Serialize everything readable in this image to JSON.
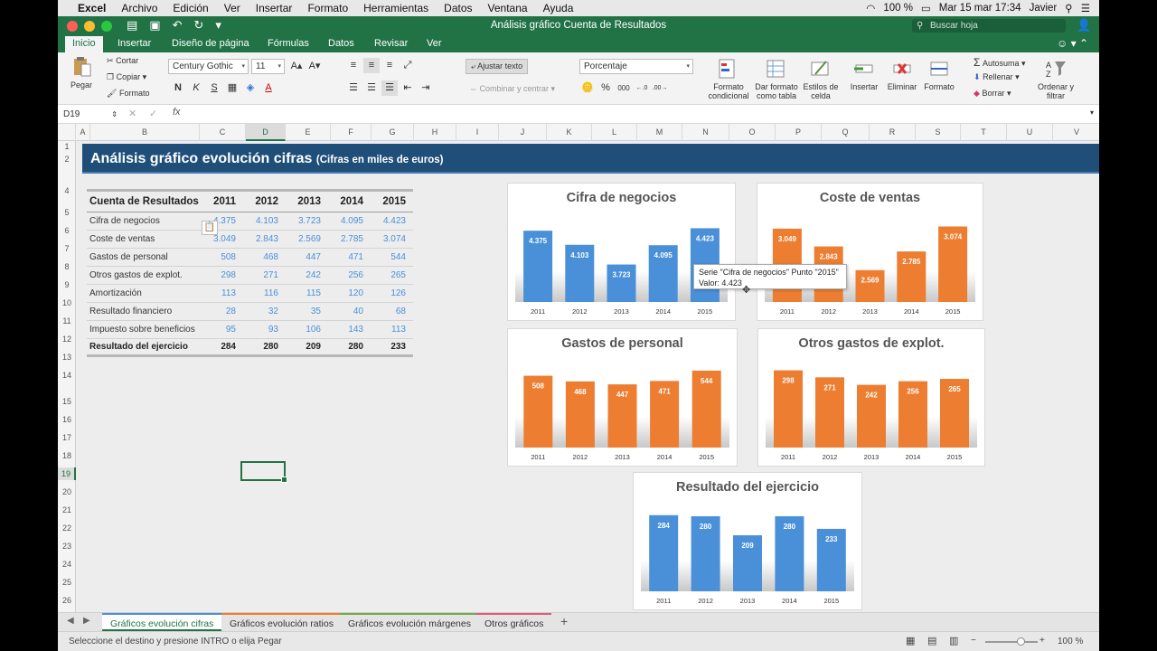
{
  "menubar": {
    "app": "Excel",
    "items": [
      "Archivo",
      "Edición",
      "Ver",
      "Insertar",
      "Formato",
      "Herramientas",
      "Datos",
      "Ventana",
      "Ayuda"
    ],
    "battery": "100 %",
    "datetime": "Mar 15 mar 17:34",
    "user": "Javier"
  },
  "window": {
    "title": "Análisis gráfico Cuenta de Resultados",
    "search_placeholder": "Buscar hoja"
  },
  "ribbon_tabs": [
    "Inicio",
    "Insertar",
    "Diseño de página",
    "Fórmulas",
    "Datos",
    "Revisar",
    "Ver"
  ],
  "ribbon": {
    "paste": "Pegar",
    "cut": "Cortar",
    "copy": "Copiar",
    "format_painter": "Formato",
    "font_name": "Century Gothic",
    "font_size": "11",
    "bold": "N",
    "italic": "K",
    "underline": "S",
    "wrap_text": "Ajustar texto",
    "merge": "Combinar y centrar",
    "number_format": "Porcentaje",
    "percent": "%",
    "thousands": "000",
    "cond_format": "Formato condicional",
    "table_format": "Dar formato como tabla",
    "cell_styles": "Estilos de celda",
    "insert": "Insertar",
    "delete": "Eliminar",
    "format": "Formato",
    "autosum": "Autosuma",
    "fill": "Rellenar",
    "clear": "Borrar",
    "sort_filter": "Ordenar y filtrar"
  },
  "formula_bar": {
    "name_box": "D19",
    "fx": "fx",
    "value": ""
  },
  "columns": [
    "A",
    "B",
    "C",
    "D",
    "E",
    "F",
    "G",
    "H",
    "I",
    "J",
    "K",
    "L",
    "M",
    "N",
    "O",
    "P",
    "Q",
    "R",
    "S",
    "T",
    "U",
    "V"
  ],
  "selected_column": "D",
  "rows": [
    "1",
    "2",
    "4",
    "5",
    "6",
    "7",
    "8",
    "9",
    "10",
    "11",
    "12",
    "13",
    "14",
    "15",
    "16",
    "17",
    "18",
    "19",
    "20",
    "21",
    "22",
    "23",
    "24",
    "25",
    "26"
  ],
  "selected_row": "19",
  "banner": {
    "title": "Análisis gráfico evolución cifras",
    "subtitle": "(Cifras en miles de euros)"
  },
  "table": {
    "header": [
      "Cuenta de Resultados",
      "2011",
      "2012",
      "2013",
      "2014",
      "2015"
    ],
    "rows": [
      [
        "Cifra de negocios",
        "4.375",
        "4.103",
        "3.723",
        "4.095",
        "4.423"
      ],
      [
        "Coste de ventas",
        "3.049",
        "2.843",
        "2.569",
        "2.785",
        "3.074"
      ],
      [
        "Gastos de personal",
        "508",
        "468",
        "447",
        "471",
        "544"
      ],
      [
        "Otros gastos de explot.",
        "298",
        "271",
        "242",
        "256",
        "265"
      ],
      [
        "Amortización",
        "113",
        "116",
        "115",
        "120",
        "126"
      ],
      [
        "Resultado financiero",
        "28",
        "32",
        "35",
        "40",
        "68"
      ],
      [
        "Impuesto sobre beneficios",
        "95",
        "93",
        "106",
        "143",
        "113"
      ]
    ],
    "total": [
      "Resultado del ejercicio",
      "284",
      "280",
      "209",
      "280",
      "233"
    ]
  },
  "chart_data": [
    {
      "type": "bar",
      "title": "Cifra de negocios",
      "categories": [
        "2011",
        "2012",
        "2013",
        "2014",
        "2015"
      ],
      "values": [
        4375,
        4103,
        3723,
        4095,
        4423
      ],
      "labels": [
        "4.375",
        "4.103",
        "3.723",
        "4.095",
        "4.423"
      ],
      "ylim": [
        3000,
        4500
      ],
      "color": "#4a90d9"
    },
    {
      "type": "bar",
      "title": "Coste de ventas",
      "categories": [
        "2011",
        "2012",
        "2013",
        "2014",
        "2015"
      ],
      "values": [
        3049,
        2843,
        2569,
        2785,
        3074
      ],
      "labels": [
        "3.049",
        "2.843",
        "2.569",
        "2.785",
        "3.074"
      ],
      "ylim": [
        2200,
        3100
      ],
      "color": "#ed7d31"
    },
    {
      "type": "bar",
      "title": "Gastos de personal",
      "categories": [
        "2011",
        "2012",
        "2013",
        "2014",
        "2015"
      ],
      "values": [
        508,
        468,
        447,
        471,
        544
      ],
      "labels": [
        "508",
        "468",
        "447",
        "471",
        "544"
      ],
      "ylim": [
        0,
        550
      ],
      "color": "#ed7d31"
    },
    {
      "type": "bar",
      "title": "Otros gastos de explot.",
      "categories": [
        "2011",
        "2012",
        "2013",
        "2014",
        "2015"
      ],
      "values": [
        298,
        271,
        242,
        256,
        265
      ],
      "labels": [
        "298",
        "271",
        "242",
        "256",
        "265"
      ],
      "ylim": [
        0,
        300
      ],
      "color": "#ed7d31"
    },
    {
      "type": "bar",
      "title": "Resultado del ejercicio",
      "categories": [
        "2011",
        "2012",
        "2013",
        "2014",
        "2015"
      ],
      "values": [
        284,
        280,
        209,
        280,
        233
      ],
      "labels": [
        "284",
        "280",
        "209",
        "280",
        "233"
      ],
      "ylim": [
        0,
        290
      ],
      "color": "#4a90d9"
    }
  ],
  "tooltip": {
    "line1": "Serie \"Cifra de negocios\" Punto \"2015\"",
    "line2": "Valor: 4.423"
  },
  "sheet_tabs": [
    "Gráficos evolución cifras",
    "Gráficos evolución ratios",
    "Gráficos evolución márgenes",
    "Otros gráficos"
  ],
  "statusbar": {
    "message": "Seleccione el destino y presione INTRO o elija Pegar",
    "zoom": "100 %"
  }
}
